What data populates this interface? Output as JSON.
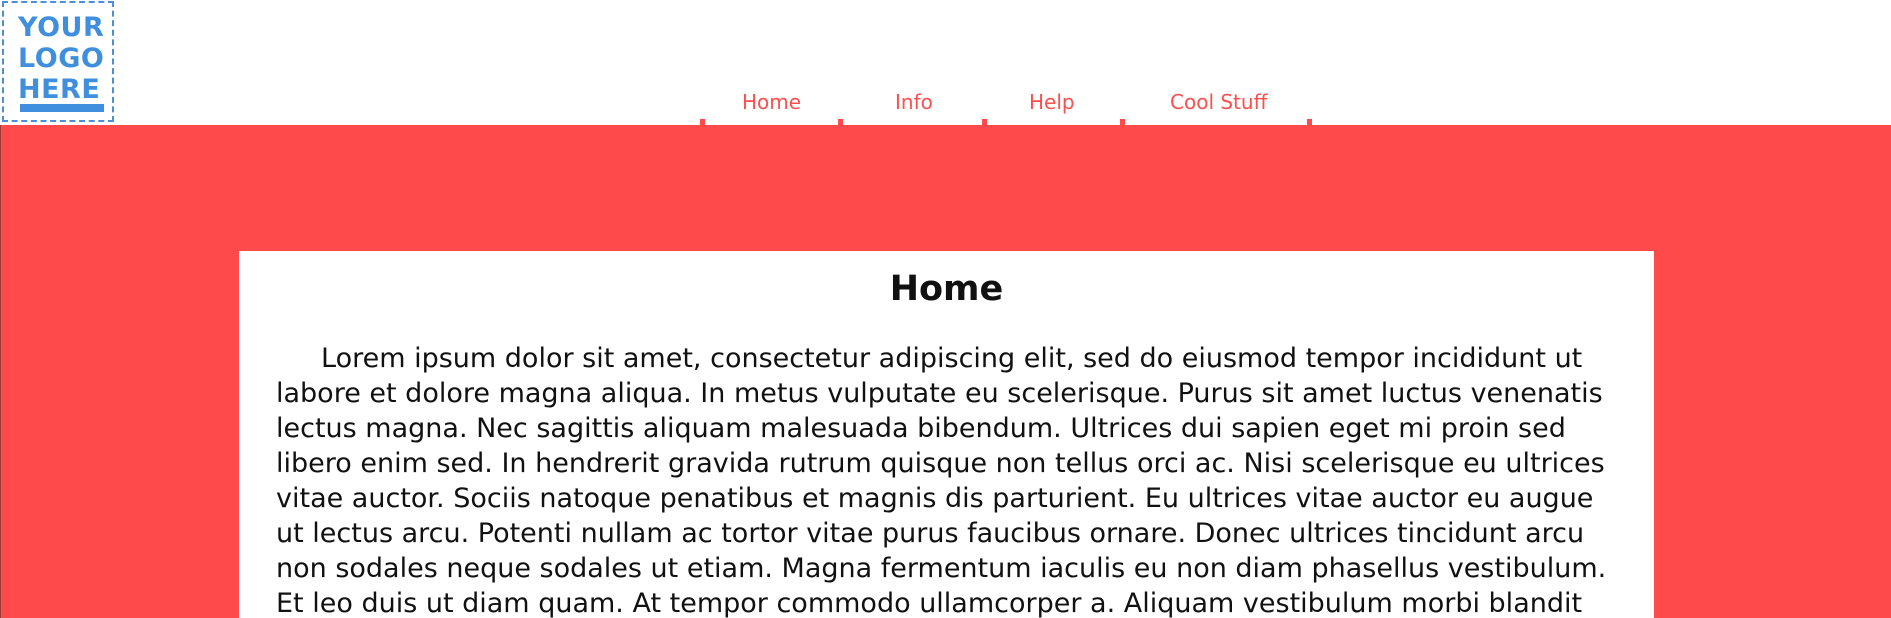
{
  "logo": {
    "lines": [
      "YOUR",
      "LOGO",
      "HERE"
    ]
  },
  "nav": {
    "items": [
      {
        "label": "Home"
      },
      {
        "label": "Info"
      },
      {
        "label": "Help"
      },
      {
        "label": "Cool Stuff"
      }
    ]
  },
  "main": {
    "title": "Home",
    "paragraph": "Lorem ipsum dolor sit amet, consectetur adipiscing elit, sed do eiusmod tempor incididunt ut labore et dolore magna aliqua. In metus vulputate eu scelerisque. Purus sit amet luctus venenatis lectus magna. Nec sagittis aliquam malesuada bibendum. Ultrices dui sapien eget mi proin sed libero enim sed. In hendrerit gravida rutrum quisque non tellus orci ac. Nisi scelerisque eu ultrices vitae auctor. Sociis natoque penatibus et magnis dis parturient. Eu ultrices vitae auctor eu augue ut lectus arcu. Potenti nullam ac tortor vitae purus faucibus ornare. Donec ultrices tincidunt arcu non sodales neque sodales ut etiam. Magna fermentum iaculis eu non diam phasellus vestibulum. Et leo duis ut diam quam. At tempor commodo ullamcorper a. Aliquam vestibulum morbi blandit"
  },
  "colors": {
    "accent_red": "#ff4a4b",
    "logo_blue": "#3f8fde"
  }
}
